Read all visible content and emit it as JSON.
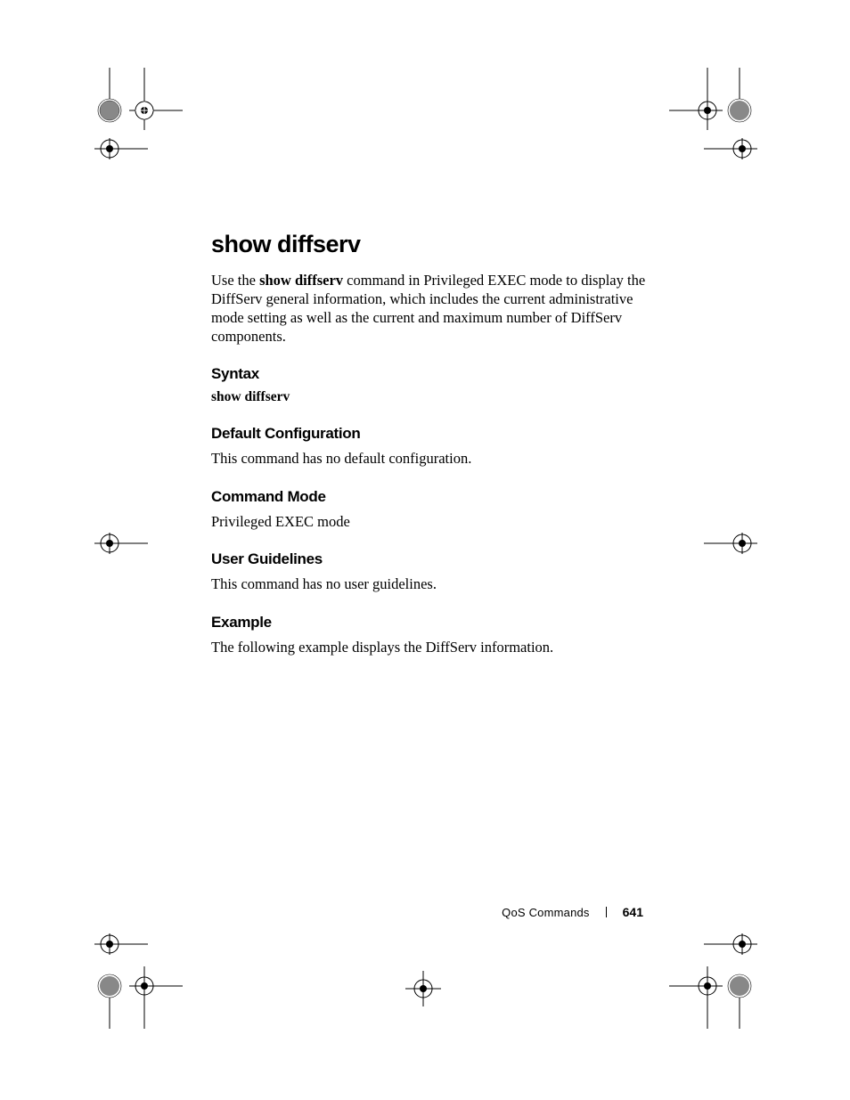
{
  "heading": "show diffserv",
  "intro": {
    "prefix": "Use the ",
    "cmd": "show diffserv",
    "suffix": " command in Privileged EXEC mode to display the DiffServ general information, which includes the current administrative mode setting as well as the current and maximum number of DiffServ components."
  },
  "sections": {
    "syntax": {
      "title": "Syntax",
      "cmd": "show diffserv"
    },
    "default_config": {
      "title": "Default Configuration",
      "text": "This command has no default configuration."
    },
    "command_mode": {
      "title": "Command Mode",
      "text": "Privileged EXEC mode"
    },
    "user_guidelines": {
      "title": "User Guidelines",
      "text": "This command has no user guidelines."
    },
    "example": {
      "title": "Example",
      "text": "The following example displays the DiffServ information."
    }
  },
  "footer": {
    "section_label": "QoS Commands",
    "page_number": "641"
  }
}
